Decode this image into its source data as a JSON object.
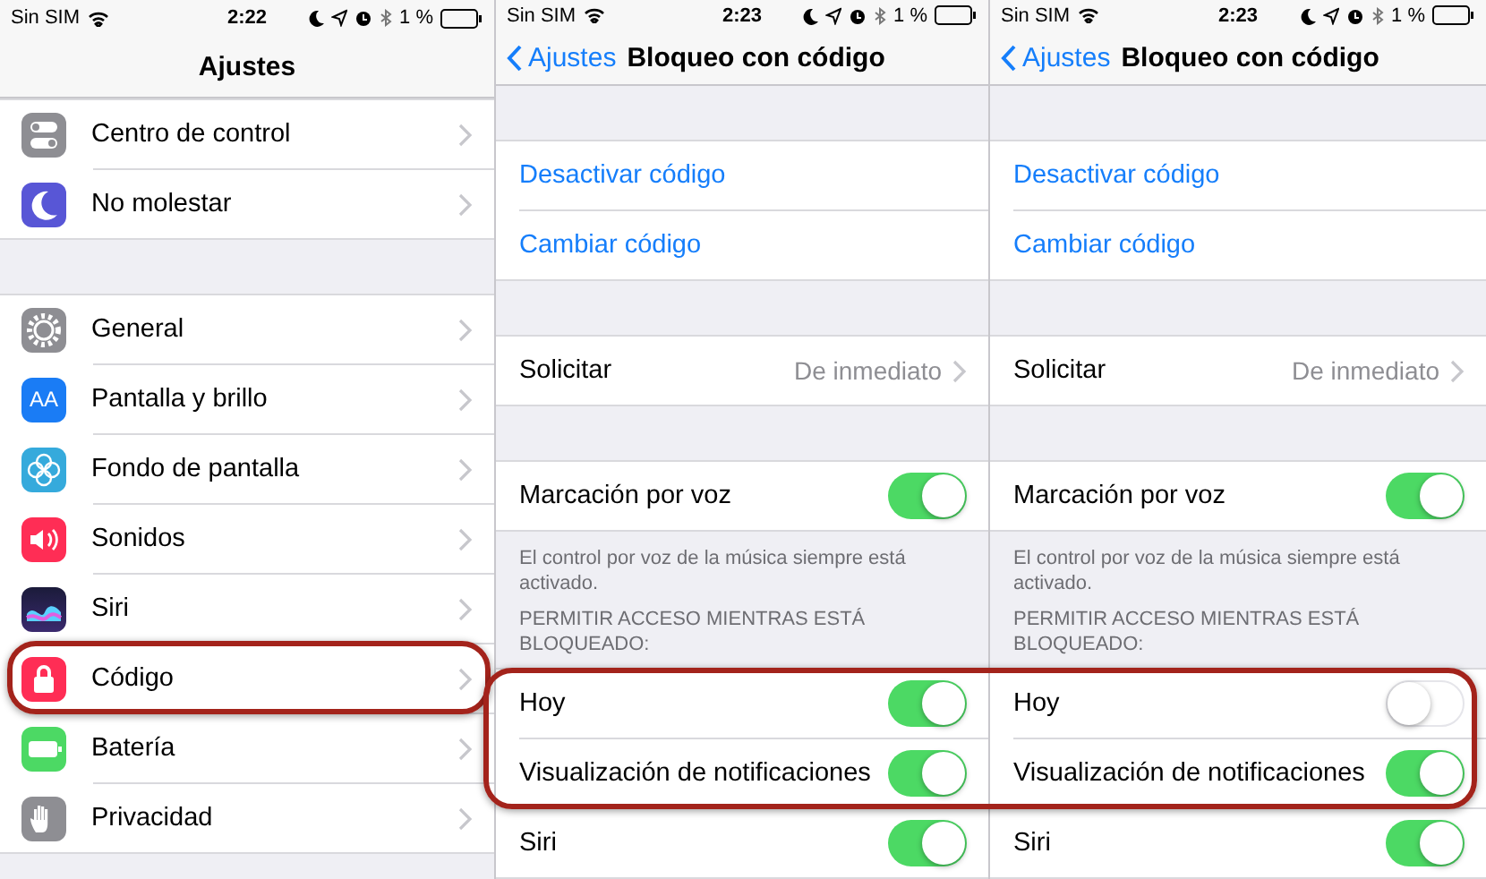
{
  "panels": [
    {
      "status_bar": {
        "carrier": "Sin SIM",
        "time": "2:22",
        "battery": "1 %"
      },
      "nav": {
        "title": "Ajustes"
      },
      "scrolled": true,
      "sections": [
        {
          "rows": [
            {
              "kind": "nav",
              "label": "Centro de control",
              "color": "#8e8e93",
              "highlighted": false
            },
            {
              "kind": "nav",
              "label": "No molestar",
              "color": "#5856d6",
              "highlighted": false
            }
          ]
        },
        {
          "rows": [
            {
              "kind": "nav",
              "label": "General",
              "color": "#8e8e93",
              "highlighted": false
            },
            {
              "kind": "nav",
              "label": "Pantalla y brillo",
              "icon_text": "AA",
              "color": "#1a7cf5",
              "highlighted": false
            },
            {
              "kind": "nav",
              "label": "Fondo de pantalla",
              "color": "#35aadc",
              "highlighted": false
            },
            {
              "kind": "nav",
              "label": "Sonidos",
              "color": "#ff2d55",
              "highlighted": false
            },
            {
              "kind": "nav",
              "label": "Siri",
              "color": "#3a2a6e",
              "highlighted": false
            },
            {
              "kind": "nav",
              "label": "Código",
              "color": "#ff2d55",
              "highlighted": true
            },
            {
              "kind": "nav",
              "label": "Batería",
              "color": "#4cd964",
              "highlighted": false
            },
            {
              "kind": "nav",
              "label": "Privacidad",
              "color": "#8e8e93",
              "highlighted": false
            }
          ]
        }
      ]
    },
    {
      "status_bar": {
        "carrier": "Sin SIM",
        "time": "2:23",
        "battery": "1 %"
      },
      "nav": {
        "back": "Ajustes",
        "title": "Bloqueo con código"
      },
      "scrolled": false,
      "sections": [
        {
          "rows": [
            {
              "kind": "link",
              "label": "Desactivar código",
              "highlighted": false
            },
            {
              "kind": "link",
              "label": "Cambiar código",
              "highlighted": false
            }
          ]
        },
        {
          "rows": [
            {
              "kind": "value",
              "label": "Solicitar",
              "value": "De inmediato",
              "highlighted": false
            }
          ]
        },
        {
          "rows": [
            {
              "kind": "toggle",
              "label": "Marcación por voz",
              "on": true,
              "highlighted": false
            }
          ],
          "footer": "El control por voz de la música siempre está activado."
        },
        {
          "header": "PERMITIR ACCESO MIENTRAS ESTÁ BLOQUEADO:",
          "rows": [
            {
              "kind": "toggle",
              "label": "Hoy",
              "on": true,
              "highlighted": true
            },
            {
              "kind": "toggle",
              "label": "Visualización de notificaciones",
              "on": true,
              "highlighted": true
            },
            {
              "kind": "toggle",
              "label": "Siri",
              "on": true,
              "highlighted": false
            }
          ]
        }
      ]
    },
    {
      "status_bar": {
        "carrier": "Sin SIM",
        "time": "2:23",
        "battery": "1 %"
      },
      "nav": {
        "back": "Ajustes",
        "title": "Bloqueo con código"
      },
      "scrolled": false,
      "sections": [
        {
          "rows": [
            {
              "kind": "link",
              "label": "Desactivar código",
              "highlighted": false
            },
            {
              "kind": "link",
              "label": "Cambiar código",
              "highlighted": false
            }
          ]
        },
        {
          "rows": [
            {
              "kind": "value",
              "label": "Solicitar",
              "value": "De inmediato",
              "highlighted": false
            }
          ]
        },
        {
          "rows": [
            {
              "kind": "toggle",
              "label": "Marcación por voz",
              "on": true,
              "highlighted": false
            }
          ],
          "footer": "El control por voz de la música siempre está activado."
        },
        {
          "header": "PERMITIR ACCESO MIENTRAS ESTÁ BLOQUEADO:",
          "rows": [
            {
              "kind": "toggle",
              "label": "Hoy",
              "on": false,
              "highlighted": true
            },
            {
              "kind": "toggle",
              "label": "Visualización de notificaciones",
              "on": true,
              "highlighted": true
            },
            {
              "kind": "toggle",
              "label": "Siri",
              "on": true,
              "highlighted": false
            }
          ]
        }
      ]
    }
  ]
}
